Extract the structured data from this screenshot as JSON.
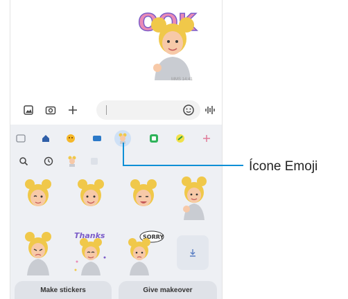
{
  "message": {
    "sticker_caption": "OOK",
    "meta": "MMS 14:41"
  },
  "compose": {
    "icons": [
      "gallery-icon",
      "camera-icon",
      "plus-icon",
      "emoji-face-icon",
      "voice-wave-icon"
    ]
  },
  "keyboard": {
    "tabs": [
      "sticker-icon",
      "home-icon",
      "emoji-icon",
      "gif-icon",
      "ar-emoji-icon",
      "spotify-icon",
      "extra-icon",
      "plus-icon"
    ],
    "selected_tab": "ar-emoji-icon",
    "sub_tabs": [
      "search-icon",
      "recent-icon",
      "avatar-mini-icon",
      "blank-icon"
    ],
    "stickers": [
      {
        "label": "avatar wink"
      },
      {
        "label": "avatar smile"
      },
      {
        "label": "avatar grin"
      },
      {
        "label": "avatar wave"
      },
      {
        "label": "avatar sad"
      },
      {
        "label": "avatar thanks"
      },
      {
        "label": "avatar sorry"
      }
    ],
    "sticker_texts": {
      "thanks": "Thanks",
      "sorry": "SORRY"
    },
    "make_stickers": "Make stickers",
    "give_makeover": "Give makeover"
  },
  "callout": {
    "label": "Ícone Emoji"
  },
  "colors": {
    "accent": "#0e8fd6",
    "keyboard_bg": "#eef0f4",
    "hair": "#f0c84a",
    "skin": "#f7c9a8",
    "hoodie": "#c9ccd2"
  }
}
